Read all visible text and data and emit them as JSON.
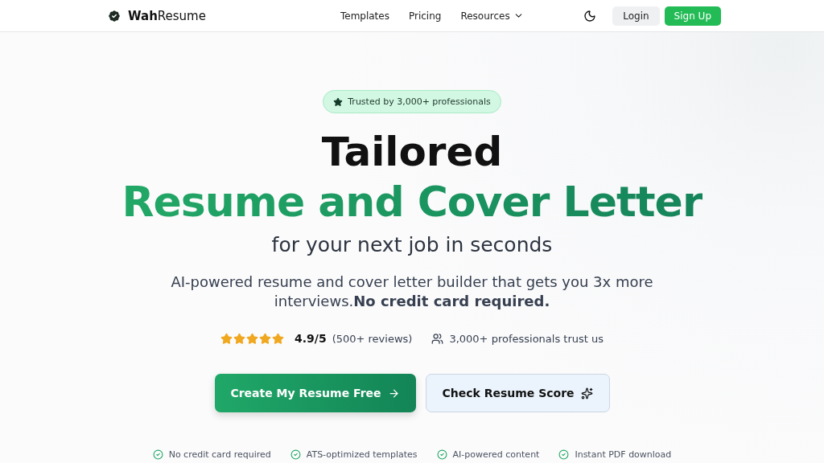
{
  "nav": {
    "logo": "**Wah**Resume",
    "links": [
      {
        "label": "Templates",
        "dropdown": false
      },
      {
        "label": "Pricing",
        "dropdown": false
      },
      {
        "label": "Resources",
        "dropdown": true
      }
    ],
    "login": "Login",
    "signup": "Sign Up"
  },
  "hero": {
    "badge": "Trusted by 3,000+ professionals",
    "title_line1": "Tailored",
    "title_line2": "Resume and Cover Letter",
    "title_line3": "for your next job in seconds",
    "description": "AI-powered resume and cover letter builder that gets you 3x more interviews.**No credit card required.**",
    "rating": {
      "stars": 5,
      "score": "4.9/5",
      "reviews": "(500+ reviews)"
    },
    "trust": "3,000+ professionals trust us",
    "primary_button": "Create My Resume Free",
    "secondary_button": "Check Resume Score"
  },
  "features": [
    "No credit card required",
    "ATS-optimized templates",
    "AI-powered content",
    "Instant PDF download"
  ]
}
